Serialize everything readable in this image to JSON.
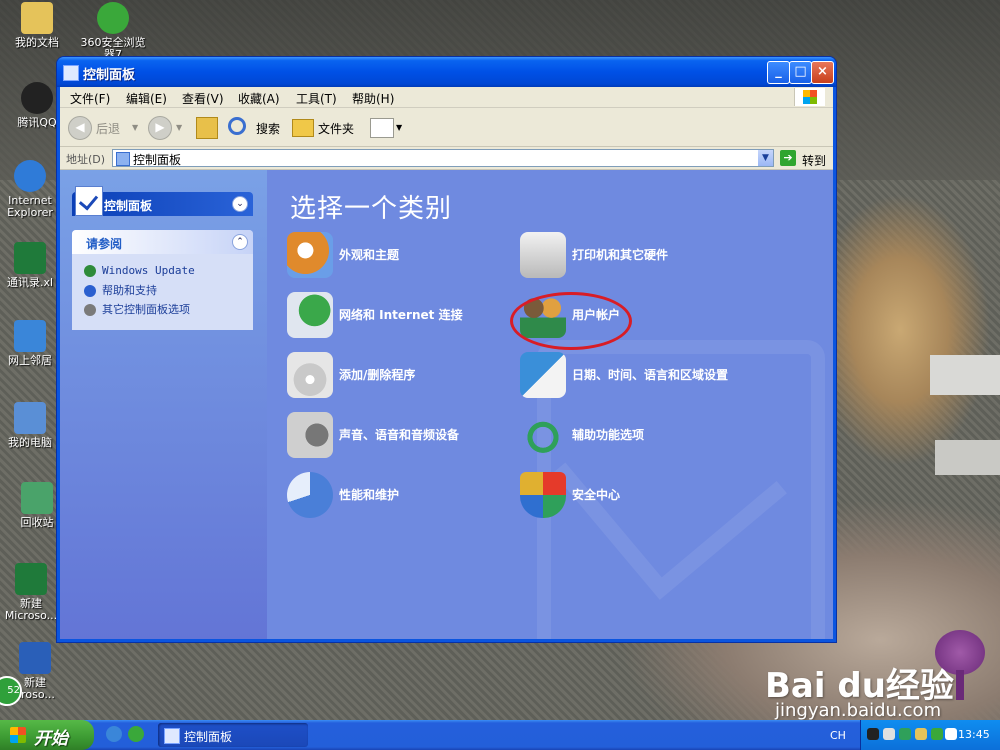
{
  "desktop": {
    "icons": [
      {
        "label": "我的文档",
        "color": "#e5c35a"
      },
      {
        "label": "360安全浏览器7",
        "color": "#3aa83a"
      },
      {
        "label": "腾讯QQ",
        "color": "#222222"
      },
      {
        "label": "Internet Explorer",
        "color": "#2f7bd8"
      },
      {
        "label": "通讯录.xl",
        "color": "#1f7a3a"
      },
      {
        "label": "网上邻居",
        "color": "#3a86d9"
      },
      {
        "label": "我的电脑",
        "color": "#5a8fd6"
      },
      {
        "label": "回收站",
        "color": "#4aa36a"
      },
      {
        "label": "新建 Microso...",
        "color": "#1f7a3a"
      },
      {
        "label": "新建 croso...",
        "color": "#2a5fb8"
      }
    ]
  },
  "window": {
    "title": "控制面板",
    "menu": [
      "文件(F)",
      "编辑(E)",
      "查看(V)",
      "收藏(A)",
      "工具(T)",
      "帮助(H)"
    ],
    "toolbar": {
      "back": "后退",
      "search": "搜索",
      "folders": "文件夹"
    },
    "address": {
      "label": "地址(D)",
      "value": "控制面板",
      "go": "转到"
    }
  },
  "left_pane": {
    "control_panel_title": "控制面板",
    "see_also_title": "请参阅",
    "links": [
      {
        "label": "Windows Update",
        "color": "#2e8b3a"
      },
      {
        "label": "帮助和支持",
        "color": "#2b5fcf"
      },
      {
        "label": "其它控制面板选项",
        "color": "#7a7a7a"
      }
    ]
  },
  "main": {
    "heading": "选择一个类别",
    "categories": [
      {
        "label": "外观和主题",
        "color": "#e08a2c"
      },
      {
        "label": "打印机和其它硬件",
        "color": "#d9d9d9"
      },
      {
        "label": "网络和 Internet 连接",
        "color": "#3aa84a"
      },
      {
        "label": "用户帐户",
        "color": "#d48a2a"
      },
      {
        "label": "添加/删除程序",
        "color": "#c9c9c9"
      },
      {
        "label": "日期、时间、语言和区域设置",
        "color": "#3a8fd9"
      },
      {
        "label": "声音、语音和音频设备",
        "color": "#a8a8a8"
      },
      {
        "label": "辅助功能选项",
        "color": "#2fa05a"
      },
      {
        "label": "性能和维护",
        "color": "#4a7fd8"
      },
      {
        "label": "安全中心",
        "color": "#e0b030"
      }
    ]
  },
  "taskbar": {
    "start": "开始",
    "task_item": "控制面板",
    "lang": "CH",
    "clock": "13:45"
  },
  "watermark": {
    "brand": "Bai du经验",
    "url": "jingyan.baidu.com"
  },
  "misc": {
    "badge": "52"
  }
}
